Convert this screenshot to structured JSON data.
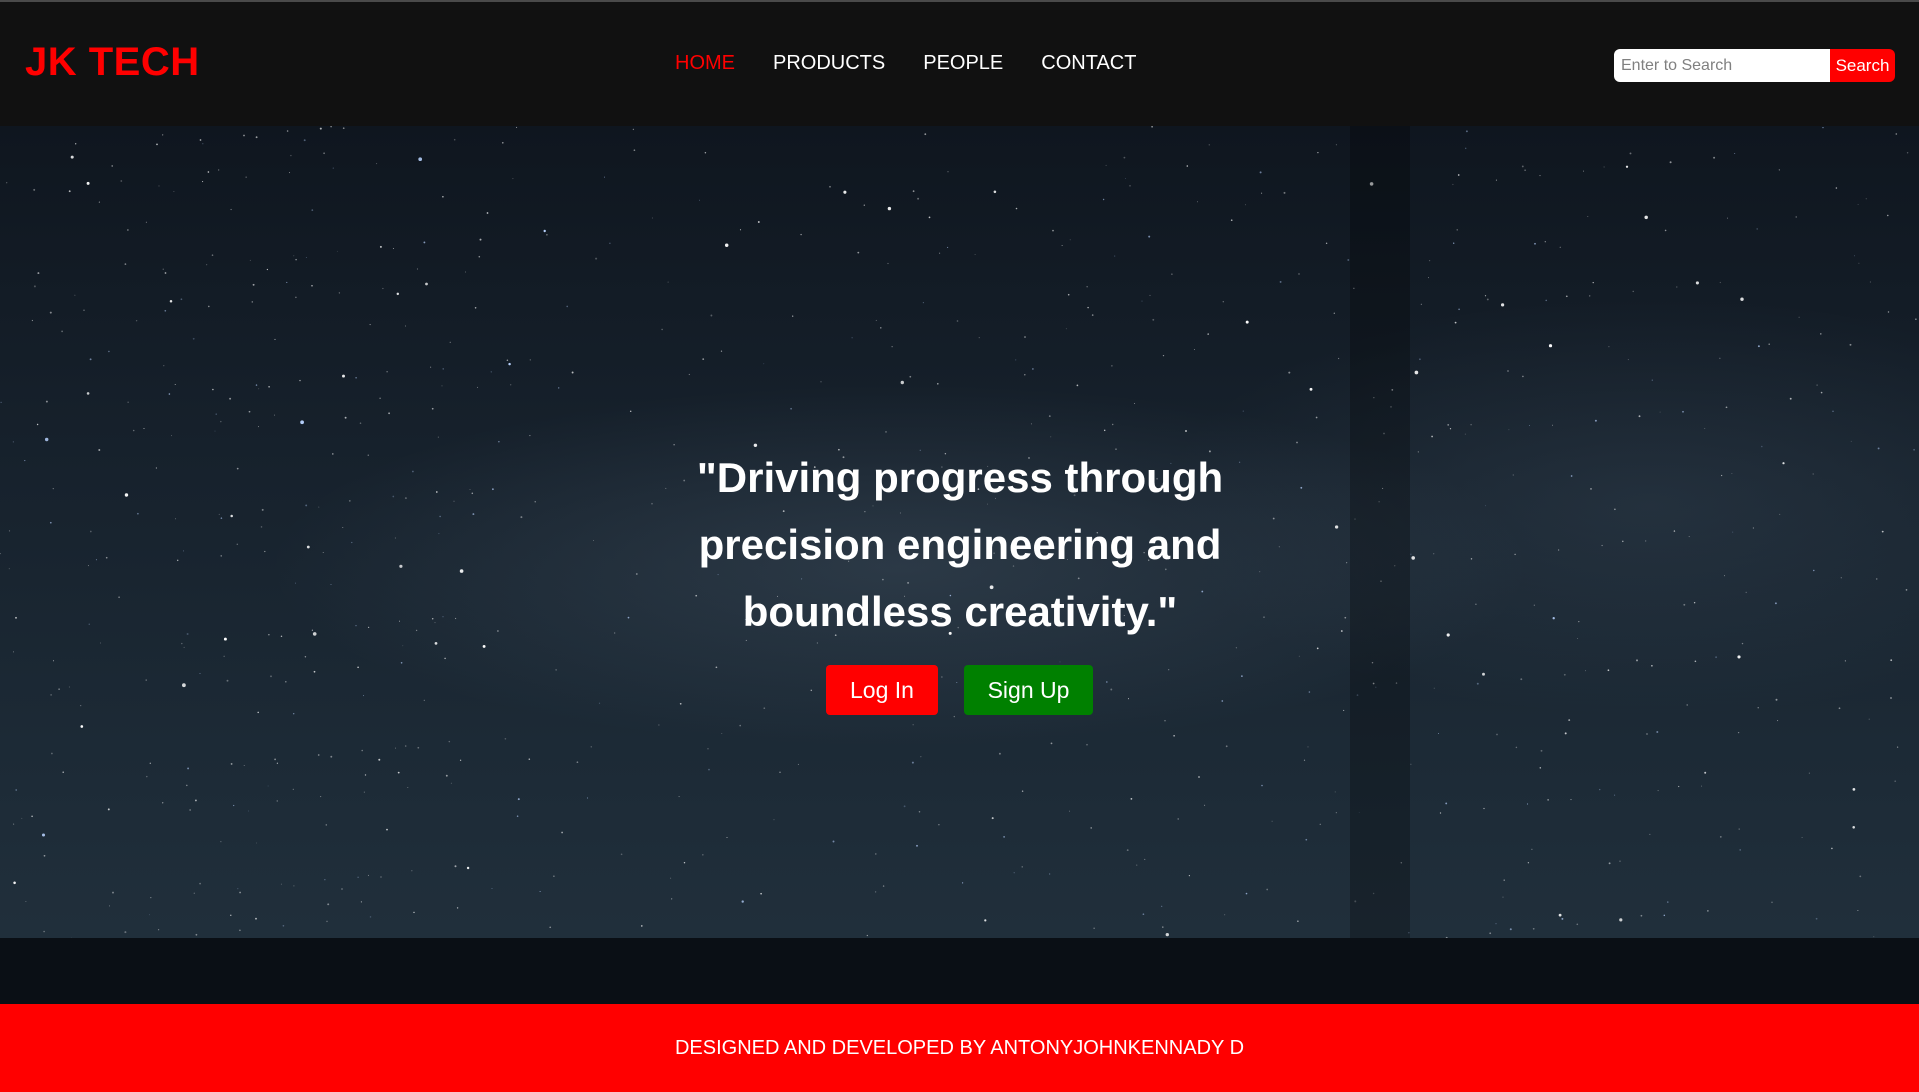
{
  "brand": {
    "logo_text": "JK TECH",
    "accent_color": "#ff0000"
  },
  "nav": {
    "items": [
      {
        "label": "HOME",
        "active": true
      },
      {
        "label": "PRODUCTS",
        "active": false
      },
      {
        "label": "PEOPLE",
        "active": false
      },
      {
        "label": "CONTACT",
        "active": false
      }
    ]
  },
  "search": {
    "placeholder": "Enter to Search",
    "value": "",
    "button_label": "Search"
  },
  "hero": {
    "quote": "\"Driving progress through precision engineering and boundless creativity.\"",
    "login_label": "Log In",
    "signup_label": "Sign Up",
    "login_color": "#ff0000",
    "signup_color": "#008000"
  },
  "footer": {
    "text": "DESIGNED AND DEVELOPED BY ANTONYJOHNKENNADY D"
  }
}
